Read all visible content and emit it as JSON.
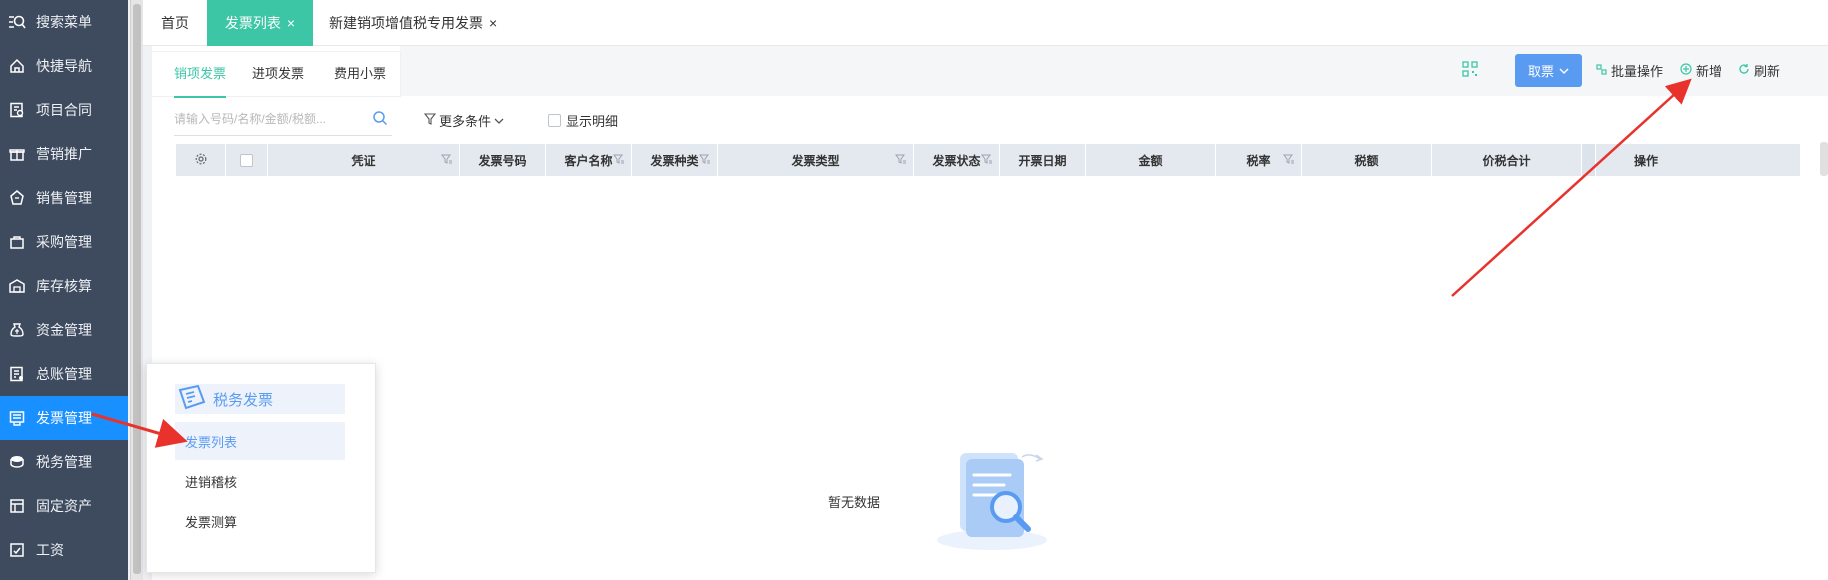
{
  "sidebar": {
    "items": [
      {
        "label": "搜索菜单",
        "icon": "search-menu-icon"
      },
      {
        "label": "快捷导航",
        "icon": "home-icon"
      },
      {
        "label": "项目合同",
        "icon": "contract-icon"
      },
      {
        "label": "营销推广",
        "icon": "gift-icon"
      },
      {
        "label": "销售管理",
        "icon": "sales-icon"
      },
      {
        "label": "采购管理",
        "icon": "bag-icon"
      },
      {
        "label": "库存核算",
        "icon": "warehouse-icon"
      },
      {
        "label": "资金管理",
        "icon": "money-icon"
      },
      {
        "label": "总账管理",
        "icon": "ledger-icon"
      },
      {
        "label": "发票管理",
        "icon": "invoice-icon"
      },
      {
        "label": "税务管理",
        "icon": "tax-icon"
      },
      {
        "label": "固定资产",
        "icon": "asset-icon"
      },
      {
        "label": "工资",
        "icon": "salary-icon"
      }
    ]
  },
  "tabs": [
    {
      "label": "首页"
    },
    {
      "label": "发票列表",
      "close": "×"
    },
    {
      "label": "新建销项增值税专用发票",
      "close": "×"
    }
  ],
  "subtabs": [
    "销项发票",
    "进项发票",
    "费用小票"
  ],
  "toolbar": {
    "fetch_label": "取票",
    "batch_label": "批量操作",
    "add_label": "新增",
    "refresh_label": "刷新"
  },
  "search": {
    "placeholder": "请输入号码/名称/金额/税额..."
  },
  "filters": {
    "more_label": "更多条件",
    "show_detail_label": "显示明细"
  },
  "table": {
    "columns": [
      "凭证",
      "发票号码",
      "客户名称",
      "发票种类",
      "发票类型",
      "发票状态",
      "开票日期",
      "金额",
      "税率",
      "税额",
      "价税合计",
      "操作"
    ]
  },
  "empty": {
    "text": "暂无数据"
  },
  "popup": {
    "title": "税务发票",
    "items": [
      "发票列表",
      "进销稽核",
      "发票测算"
    ]
  },
  "colors": {
    "accent": "#3dc6a6",
    "primary": "#5a9bf2",
    "sidebar": "#3e4a5e",
    "active": "#1890ff",
    "annotation": "#e8322b"
  }
}
